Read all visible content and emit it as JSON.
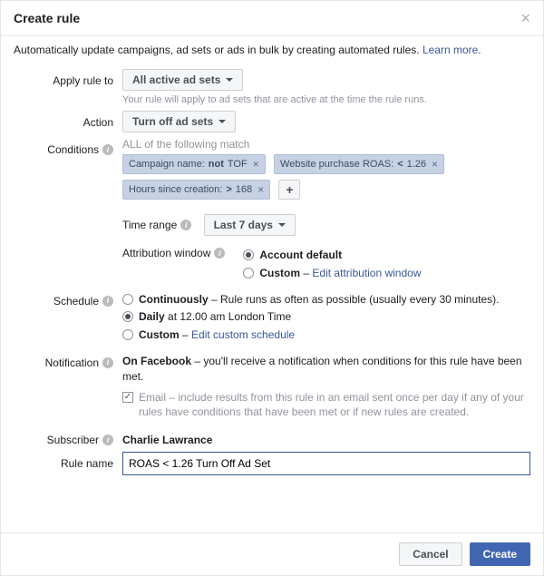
{
  "header": {
    "title": "Create rule"
  },
  "subtext": {
    "text": "Automatically update campaigns, ad sets or ads in bulk by creating automated rules.",
    "learn_more": "Learn more."
  },
  "apply_rule": {
    "label": "Apply rule to",
    "value": "All active ad sets",
    "helper": "Your rule will apply to ad sets that are active at the time the rule runs."
  },
  "action": {
    "label": "Action",
    "value": "Turn off ad sets"
  },
  "conditions": {
    "label": "Conditions",
    "match_text": "ALL of the following match",
    "chips": [
      {
        "field": "Campaign name:",
        "op": "not",
        "val": "TOF"
      },
      {
        "field": "Website purchase ROAS:",
        "op": "<",
        "val": "1.26"
      },
      {
        "field": "Hours since creation:",
        "op": ">",
        "val": "168"
      }
    ],
    "time_range_label": "Time range",
    "time_range_value": "Last 7 days",
    "attr_label": "Attribution window",
    "attr_options": {
      "default": "Account default",
      "custom": "Custom",
      "edit_link": "Edit attribution window"
    }
  },
  "schedule": {
    "label": "Schedule",
    "cont": {
      "name": "Continuously",
      "desc": " – Rule runs as often as possible (usually every 30 minutes)."
    },
    "daily": {
      "name": "Daily",
      "desc": " at 12.00 am London Time"
    },
    "custom": {
      "name": "Custom",
      "link": "Edit custom schedule"
    }
  },
  "notification": {
    "label": "Notification",
    "fb_name": "On Facebook",
    "fb_desc": " – you'll receive a notification when conditions for this rule have been met.",
    "email_name": "Email",
    "email_desc": " – include results from this rule in an email sent once per day if any of your rules have conditions that have been met or if new rules are created."
  },
  "subscriber": {
    "label": "Subscriber",
    "name": "Charlie Lawrance"
  },
  "rule_name": {
    "label": "Rule name",
    "value": "ROAS < 1.26 Turn Off Ad Set"
  },
  "footer": {
    "cancel": "Cancel",
    "create": "Create"
  },
  "icons": {
    "info": "i",
    "x": "×",
    "plus": "+",
    "check": "✓"
  }
}
